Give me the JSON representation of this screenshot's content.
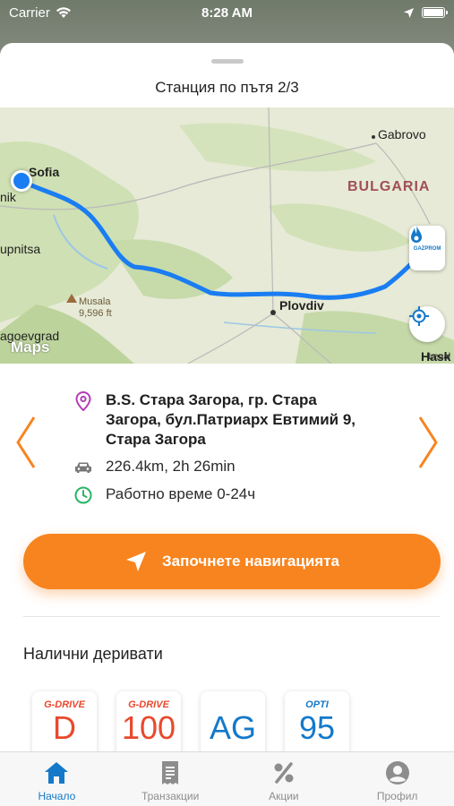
{
  "status_bar": {
    "carrier": "Carrier",
    "time": "8:28 AM",
    "battery_level": 1.0
  },
  "sheet": {
    "title": "Станция по пътя 2/3"
  },
  "map": {
    "labels": {
      "sofia": "Sofia",
      "gabrovo": "Gabrovo",
      "country": "BULGARIA",
      "plovdiv": "Plovdiv",
      "dupnitsa": "upnitsa",
      "blagoevgrad": "agoevgrad",
      "nik": "nik",
      "hask": "Hask",
      "peak_name": "Musala",
      "peak_height": "9,596 ft"
    },
    "maps_logo": "Maps",
    "legal": "Legal",
    "pin_brand": "GAZPROM"
  },
  "station": {
    "address": "B.S. Стара Загора, гр. Стара Загора,  бул.Патриарх Евтимий 9, Стара Загора",
    "distance": "226.4km, 2h 26min",
    "hours": "Работно време 0-24ч"
  },
  "navigate_label": "Започнете навигацията",
  "fuels": {
    "title": "Налични деривати",
    "items": [
      {
        "top": "G-DRIVE",
        "main": "D",
        "top_color": "#e8492d",
        "main_color": "#e8492d"
      },
      {
        "top": "G-DRIVE",
        "main": "100",
        "top_color": "#e8492d",
        "main_color": "#e8492d"
      },
      {
        "top": "",
        "main": "AG",
        "top_color": "#1479c9",
        "main_color": "#1479c9"
      },
      {
        "top": "OPTI",
        "main": "95",
        "top_color": "#1479c9",
        "main_color": "#1479c9"
      }
    ]
  },
  "tabs": [
    {
      "label": "Начало",
      "icon": "home-icon",
      "active": true
    },
    {
      "label": "Транзакции",
      "icon": "receipt-icon",
      "active": false
    },
    {
      "label": "Акции",
      "icon": "percent-icon",
      "active": false
    },
    {
      "label": "Профил",
      "icon": "profile-icon",
      "active": false
    }
  ],
  "colors": {
    "accent": "#f7841f",
    "brand_blue": "#1479c9",
    "route": "#1a7df2",
    "pin": "#b43db6",
    "clock": "#28b463"
  }
}
